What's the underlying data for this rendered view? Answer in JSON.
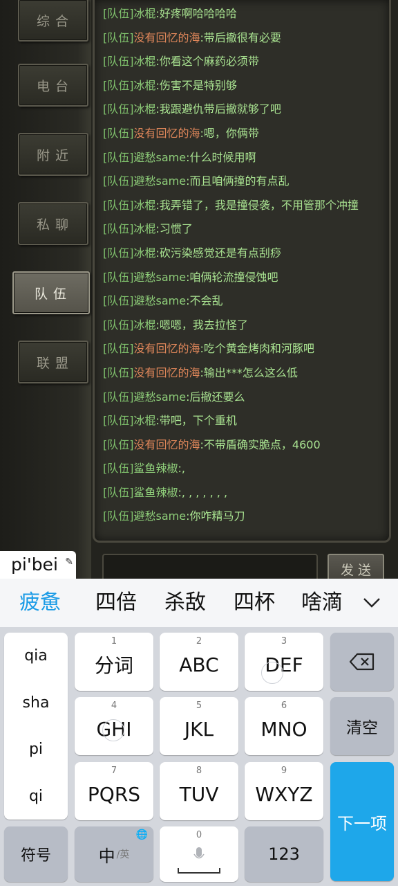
{
  "sidebar": {
    "tabs": [
      "综合",
      "电台",
      "附近",
      "私聊",
      "队伍",
      "联盟"
    ],
    "active_index": 4
  },
  "chat": {
    "messages": [
      {
        "channel": "[队伍]",
        "name": "冰棍",
        "text": ":好疼啊哈哈哈哈",
        "name_color": "green"
      },
      {
        "channel": "[队伍]",
        "name": "没有回忆的海",
        "text": ":带后撤很有必要",
        "name_color": "orange"
      },
      {
        "channel": "[队伍]",
        "name": "冰棍",
        "text": ":你看这个麻药必须带",
        "name_color": "green"
      },
      {
        "channel": "[队伍]",
        "name": "冰棍",
        "text": ":伤害不是特别够",
        "name_color": "green"
      },
      {
        "channel": "[队伍]",
        "name": "冰棍",
        "text": ":我跟避仇带后撤就够了吧",
        "name_color": "green"
      },
      {
        "channel": "[队伍]",
        "name": "没有回忆的海",
        "text": ":嗯，你俩带",
        "name_color": "orange"
      },
      {
        "channel": "[队伍]",
        "name": "避愁same",
        "text": ":什么时候用啊",
        "name_color": "green"
      },
      {
        "channel": "[队伍]",
        "name": "避愁same",
        "text": ":而且咱俩撞的有点乱",
        "name_color": "green"
      },
      {
        "channel": "[队伍]",
        "name": "冰棍",
        "text": ":我弄错了，我是撞侵袭，不用管那个冲撞",
        "name_color": "green"
      },
      {
        "channel": "[队伍]",
        "name": "冰棍",
        "text": ":习惯了",
        "name_color": "green"
      },
      {
        "channel": "[队伍]",
        "name": "冰棍",
        "text": ":砍污染感觉还是有点刮痧",
        "name_color": "green"
      },
      {
        "channel": "[队伍]",
        "name": "避愁same",
        "text": ":咱俩轮流撞侵蚀吧",
        "name_color": "green"
      },
      {
        "channel": "[队伍]",
        "name": "避愁same",
        "text": ":不会乱",
        "name_color": "green"
      },
      {
        "channel": "[队伍]",
        "name": "冰棍",
        "text": ":嗯嗯，我去拉怪了",
        "name_color": "green"
      },
      {
        "channel": "[队伍]",
        "name": "没有回忆的海",
        "text": ":吃个黄金烤肉和河豚吧",
        "name_color": "orange"
      },
      {
        "channel": "[队伍]",
        "name": "没有回忆的海",
        "text": ":输出***怎么这么低",
        "name_color": "orange"
      },
      {
        "channel": "[队伍]",
        "name": "避愁same",
        "text": ":后撤还要么",
        "name_color": "green"
      },
      {
        "channel": "[队伍]",
        "name": "冰棍",
        "text": ":带吧，下个重机",
        "name_color": "green"
      },
      {
        "channel": "[队伍]",
        "name": "没有回忆的海",
        "text": ":不带盾确实脆点，4600",
        "name_color": "orange"
      },
      {
        "channel": "[队伍]",
        "name": "鲨鱼辣椒",
        "text": ":,",
        "name_color": "green"
      },
      {
        "channel": "[队伍]",
        "name": "鲨鱼辣椒",
        "text": ":, , , , , , ,",
        "name_color": "green"
      },
      {
        "channel": "[队伍]",
        "name": "避愁same",
        "text": ":你咋精马刀",
        "name_color": "green"
      }
    ],
    "send_label": "发送",
    "input_value": ""
  },
  "ime": {
    "composing": "pi'bei",
    "candidates": [
      "疲惫",
      "四倍",
      "杀敌",
      "四杯",
      "啥滴"
    ],
    "pinyin_options": [
      "qia",
      "sha",
      "pi",
      "qi"
    ],
    "keys": {
      "row1": [
        {
          "num": "1",
          "label": "分词"
        },
        {
          "num": "2",
          "label": "ABC"
        },
        {
          "num": "3",
          "label": "DEF"
        }
      ],
      "row2": [
        {
          "num": "4",
          "label": "GHI"
        },
        {
          "num": "5",
          "label": "JKL"
        },
        {
          "num": "6",
          "label": "MNO"
        }
      ],
      "row3": [
        {
          "num": "7",
          "label": "PQRS"
        },
        {
          "num": "8",
          "label": "TUV"
        },
        {
          "num": "9",
          "label": "WXYZ"
        }
      ],
      "clear": "清空",
      "next": "下一项",
      "symbol": "符号",
      "lang_main": "中",
      "lang_sub": "/英",
      "space_num": "0",
      "numbers": "123"
    }
  },
  "colors": {
    "candidate_highlight": "#1a9be6",
    "next_key": "#1ea7ea",
    "chat_green": "#a9e391",
    "chat_orange": "#e0875a"
  }
}
